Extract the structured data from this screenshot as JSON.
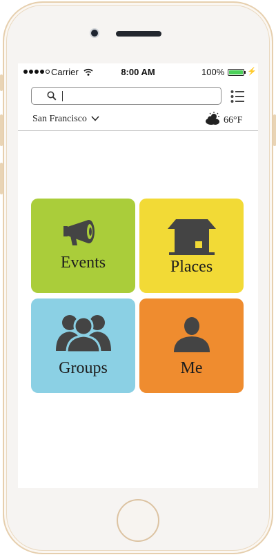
{
  "status_bar": {
    "carrier": "Carrier",
    "time": "8:00 AM",
    "battery_percent": "100%",
    "battery_level": 1.0
  },
  "search": {
    "value": "",
    "icon": "search-icon"
  },
  "menu": {
    "icon": "list-menu-icon"
  },
  "location": {
    "city": "San Francisco",
    "icon": "chevron-down-icon"
  },
  "weather": {
    "icon": "partly-cloudy-icon",
    "temperature": "66°F"
  },
  "tiles": [
    {
      "label": "Events",
      "icon": "megaphone-icon",
      "color": "#aacd3a"
    },
    {
      "label": "Places",
      "icon": "house-icon",
      "color": "#f2da36"
    },
    {
      "label": "Groups",
      "icon": "group-icon",
      "color": "#8bd0e4"
    },
    {
      "label": "Me",
      "icon": "person-icon",
      "color": "#ef8c2f"
    }
  ]
}
